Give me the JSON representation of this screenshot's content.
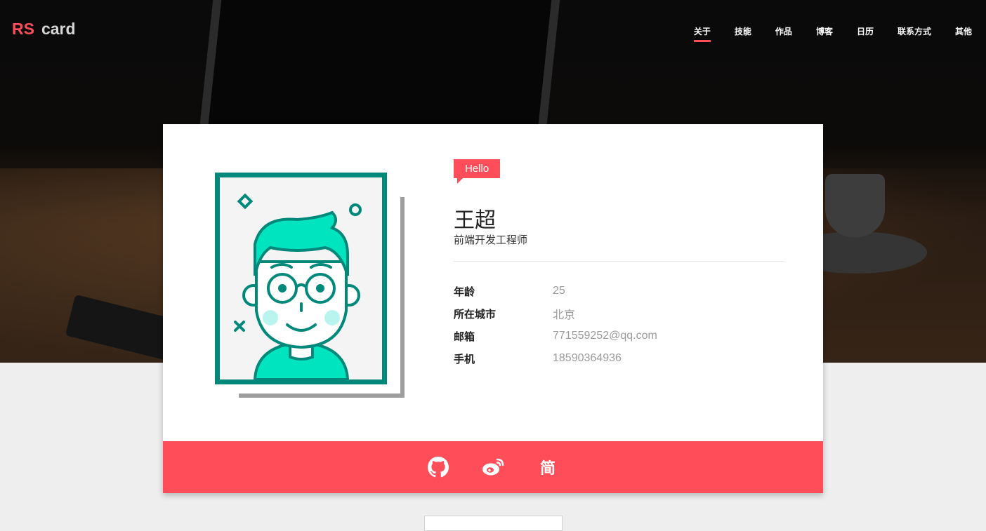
{
  "logo": {
    "rs": "RS",
    "card": "card"
  },
  "nav": {
    "items": [
      {
        "label": "关于",
        "active": true
      },
      {
        "label": "技能"
      },
      {
        "label": "作品"
      },
      {
        "label": "博客"
      },
      {
        "label": "日历"
      },
      {
        "label": "联系方式"
      },
      {
        "label": "其他"
      }
    ]
  },
  "profile": {
    "greeting": "Hello",
    "name": "王超",
    "title": "前端开发工程师",
    "info": [
      {
        "label": "年龄",
        "value": "25"
      },
      {
        "label": "所在城市",
        "value": "北京"
      },
      {
        "label": "邮箱",
        "value": "771559252@qq.com"
      },
      {
        "label": "手机",
        "value": "18590364936"
      }
    ]
  },
  "social": {
    "items": [
      {
        "icon": "github-icon"
      },
      {
        "icon": "weibo-icon"
      },
      {
        "icon": "jianshu-icon",
        "label": "简"
      }
    ]
  },
  "colors": {
    "accent": "#ff4d5a",
    "avatar_frame": "#00897b",
    "avatar_fill": "#00e5c0"
  }
}
